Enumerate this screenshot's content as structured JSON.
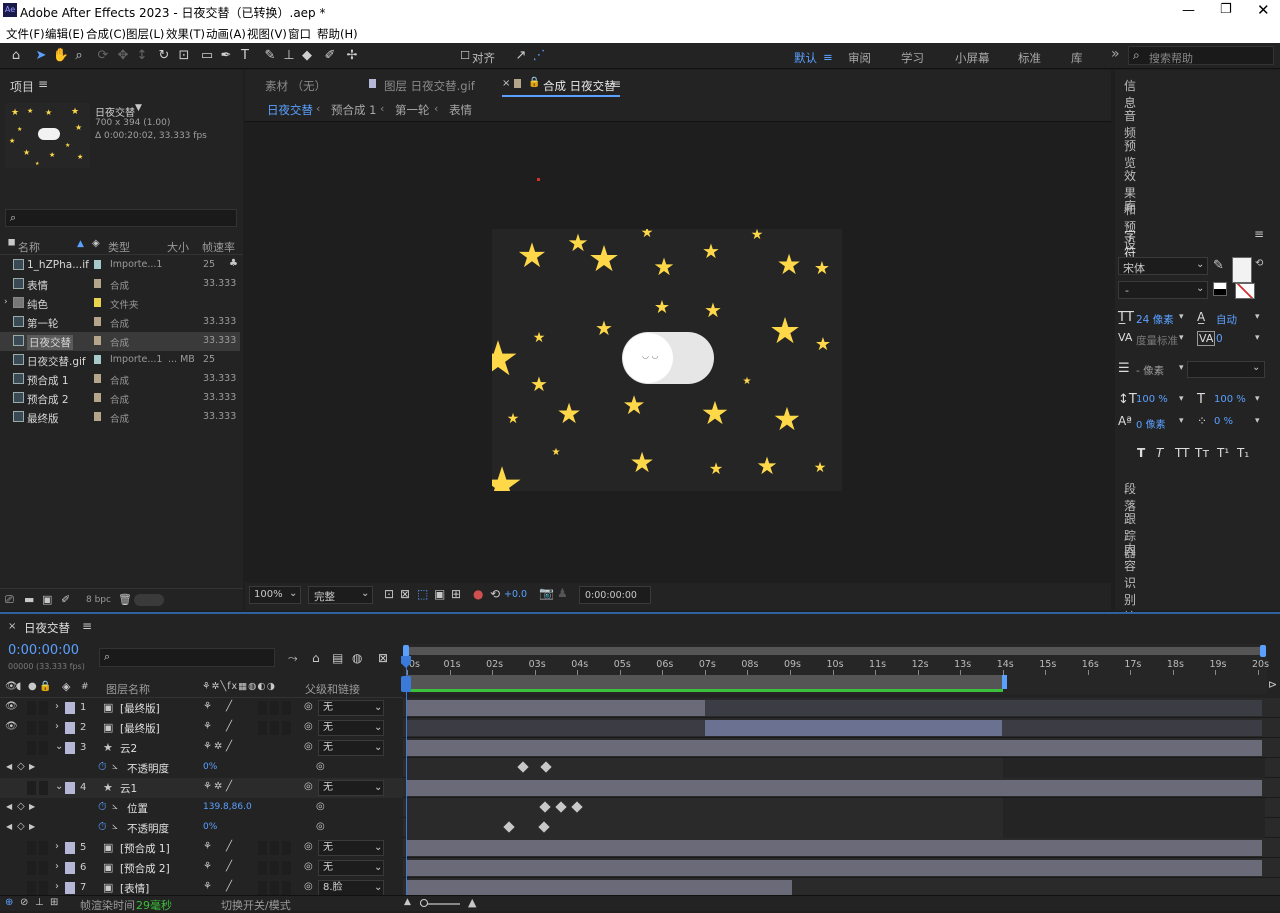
{
  "app_title": "Adobe After Effects 2023 - 日夜交替（已转换）.aep *",
  "menu": [
    "文件(F)",
    "编辑(E)",
    "合成(C)",
    "图层(L)",
    "效果(T)",
    "动画(A)",
    "视图(V)",
    "窗口",
    "帮助(H)"
  ],
  "toolbar": {
    "align_label": "对齐",
    "workspaces": [
      "默认",
      "审阅",
      "学习",
      "小屏幕",
      "标准",
      "库"
    ],
    "search_placeholder": "搜索帮助"
  },
  "project": {
    "title": "项目",
    "comp_name": "日夜交替",
    "comp_size": "700 x 394 (1.00)",
    "comp_duration": "Δ 0:00:20:02, 33.333 fps",
    "columns": [
      "名称",
      "类型",
      "大小",
      "帧速率"
    ],
    "items": [
      {
        "name": "1_hZPha...if",
        "type": "Importe...1",
        "size": "",
        "fps": "25",
        "color": "#a6c9c9"
      },
      {
        "name": "表情",
        "type": "合成",
        "size": "",
        "fps": "33.333",
        "color": "#b5a589"
      },
      {
        "name": "纯色",
        "type": "文件夹",
        "size": "",
        "fps": "",
        "color": "#e8d44d"
      },
      {
        "name": "第一轮",
        "type": "合成",
        "size": "",
        "fps": "33.333",
        "color": "#b5a589"
      },
      {
        "name": "日夜交替",
        "type": "合成",
        "size": "",
        "fps": "33.333",
        "color": "#b5a589"
      },
      {
        "name": "日夜交替.gif",
        "type": "Importe...1",
        "size": "... MB",
        "fps": "25",
        "color": "#a6c9c9"
      },
      {
        "name": "预合成 1",
        "type": "合成",
        "size": "",
        "fps": "33.333",
        "color": "#b5a589"
      },
      {
        "name": "预合成 2",
        "type": "合成",
        "size": "",
        "fps": "33.333",
        "color": "#b5a589"
      },
      {
        "name": "最终版",
        "type": "合成",
        "size": "",
        "fps": "33.333",
        "color": "#b5a589"
      }
    ],
    "bpc": "8 bpc"
  },
  "viewer": {
    "tabs": [
      "素材 （无）",
      "图层 日夜交替.gif",
      "合成 日夜交替"
    ],
    "breadcrumbs": [
      "日夜交替",
      "预合成 1",
      "第一轮",
      "表情"
    ],
    "zoom": "100%",
    "quality": "完整",
    "exposure": "+0.0",
    "timecode": "0:00:00:00"
  },
  "right_panels": [
    "信息",
    "音频",
    "预览",
    "效果和预设",
    "库",
    "字符",
    "段落",
    "跟踪器",
    "内容识别填充"
  ],
  "character": {
    "font": "宋体",
    "style": "-",
    "size": "24 像素",
    "leading": "自动",
    "kerning": "度量标准",
    "tracking": "0",
    "stroke": "- 像素",
    "vscale": "100 %",
    "hscale": "100 %",
    "baseline": "0 像素",
    "tsume": "0 %"
  },
  "timeline": {
    "comp_tab": "日夜交替",
    "timecode": "0:00:00:00",
    "fps_note": "00000 (33.333 fps)",
    "col_name": "图层名称",
    "col_parent": "父级和链接",
    "ruler": [
      "0s",
      "01s",
      "02s",
      "03s",
      "04s",
      "05s",
      "06s",
      "07s",
      "08s",
      "09s",
      "10s",
      "11s",
      "12s",
      "13s",
      "14s",
      "15s",
      "16s",
      "17s",
      "18s",
      "19s",
      "20s"
    ],
    "rows": [
      {
        "num": "1",
        "name": "[最终版]",
        "parent": "无",
        "type": "layer"
      },
      {
        "num": "2",
        "name": "[最终版]",
        "parent": "无",
        "type": "layer"
      },
      {
        "num": "3",
        "name": "云2",
        "parent": "无",
        "type": "layer"
      },
      {
        "num": "",
        "name": "不透明度",
        "value": "0%",
        "type": "prop"
      },
      {
        "num": "4",
        "name": "云1",
        "parent": "无",
        "type": "layer"
      },
      {
        "num": "",
        "name": "位置",
        "value": "139.8,86.0",
        "type": "prop"
      },
      {
        "num": "",
        "name": "不透明度",
        "value": "0%",
        "type": "prop"
      },
      {
        "num": "5",
        "name": "[预合成 1]",
        "parent": "无",
        "type": "layer"
      },
      {
        "num": "6",
        "name": "[预合成 2]",
        "parent": "无",
        "type": "layer"
      },
      {
        "num": "7",
        "name": "[表情]",
        "parent": "8.脸",
        "type": "layer"
      }
    ],
    "status_render": "帧渲染时间",
    "status_ms": "29毫秒",
    "status_switch": "切换开关/模式"
  }
}
